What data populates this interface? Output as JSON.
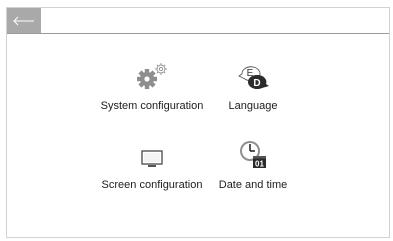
{
  "header": {
    "back_icon": "arrow-left-icon"
  },
  "menu": [
    {
      "label": "System configuration",
      "icon": "gears-icon"
    },
    {
      "label": "Language",
      "icon": "language-icon",
      "badge_back": "E",
      "badge_front": "D"
    },
    {
      "label": "Screen configuration",
      "icon": "monitor-icon"
    },
    {
      "label": "Date and time",
      "icon": "clock-calendar-icon",
      "date_text": "01"
    }
  ],
  "colors": {
    "header_bar": "#a9a9a9",
    "icon_gray": "#8e8e8e",
    "icon_dark": "#2b2b2b"
  }
}
